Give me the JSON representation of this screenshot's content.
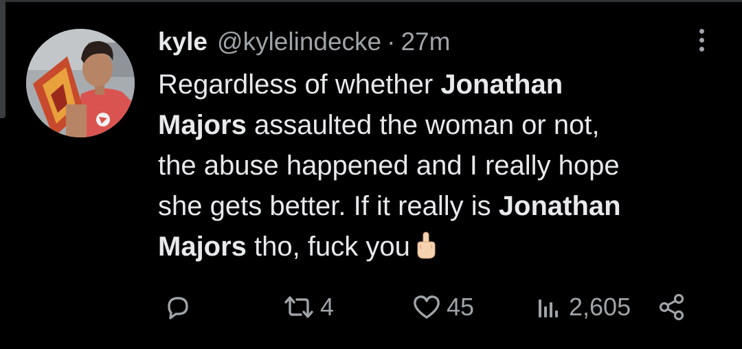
{
  "tweet": {
    "display_name": "kyle",
    "handle": "@kylelindecke",
    "separator": "·",
    "timestamp": "27m",
    "text": {
      "l1_a": "Regardless of whether ",
      "l1_b": "Jonathan",
      "l2_a": "Majors",
      "l2_b": " assaulted the woman or not,",
      "l3": "the abuse happened and I really hope",
      "l4_a": "she gets better. If it really is ",
      "l4_b": "Jonathan",
      "l5_a": "Majors",
      "l5_b": " tho, fuck you"
    },
    "emoji": "middle-finger-emoji"
  },
  "actions": {
    "reply": {
      "icon": "reply-icon",
      "count": ""
    },
    "retweet": {
      "icon": "retweet-icon",
      "count": "4"
    },
    "like": {
      "icon": "heart-icon",
      "count": "45"
    },
    "views": {
      "icon": "views-icon",
      "count": "2,605"
    },
    "share": {
      "icon": "share-icon"
    }
  },
  "colors": {
    "background": "#000000",
    "text_primary": "#e7e9ea",
    "text_secondary": "#a0a4a8"
  }
}
